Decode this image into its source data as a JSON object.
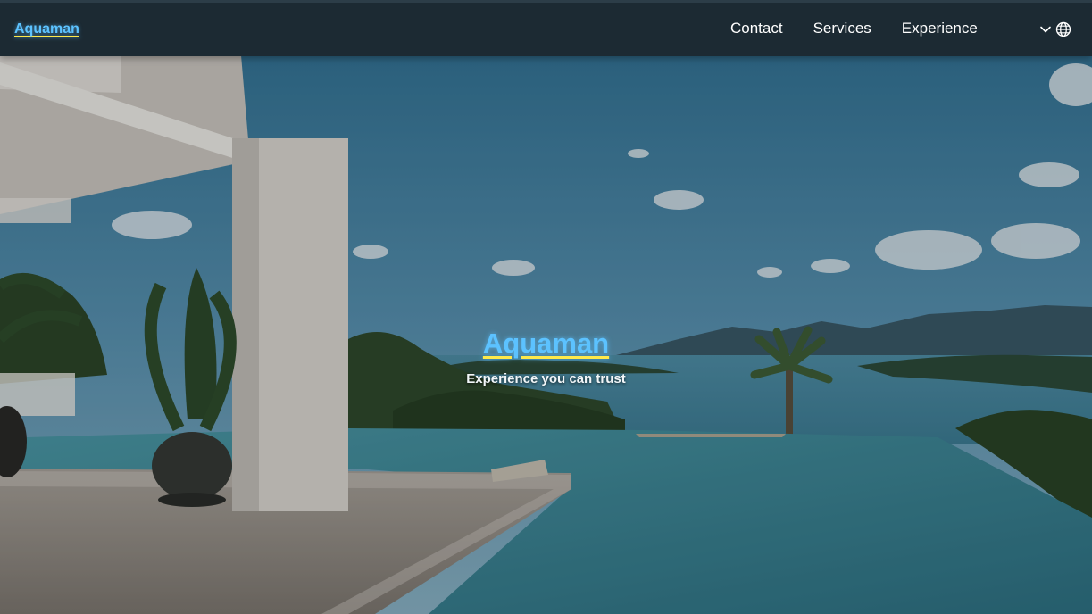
{
  "nav": {
    "brand": "Aquaman",
    "links": [
      "Contact",
      "Services",
      "Experience"
    ],
    "language_icon": "globe-icon",
    "dropdown_icon": "chevron-down-icon"
  },
  "hero": {
    "title": "Aquaman",
    "subtitle": "Experience you can trust",
    "background": "villa infinity pool overlooking bay and islands"
  },
  "colors": {
    "navbar": "#1c2a33",
    "brand_text": "#5cc2ff",
    "brand_underline": "#ffe94a",
    "nav_text": "#ffffff"
  }
}
